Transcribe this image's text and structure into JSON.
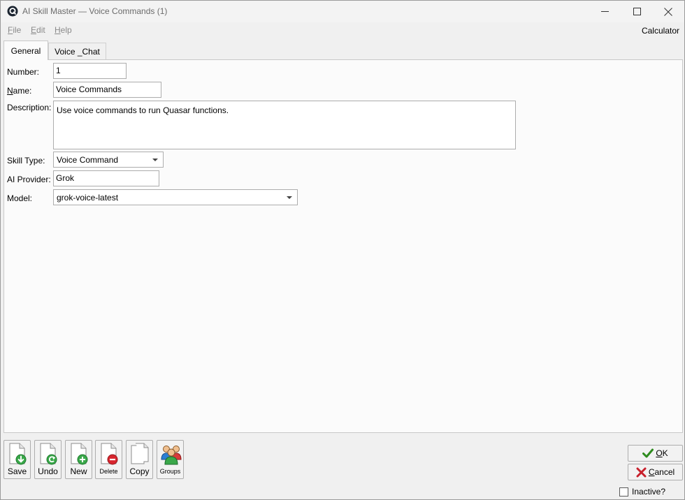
{
  "window": {
    "title": "AI Skill Master — Voice Commands (1)"
  },
  "menu": {
    "file": {
      "mnemonic": "F",
      "rest": "ile"
    },
    "edit": {
      "mnemonic": "E",
      "rest": "dit"
    },
    "help": {
      "mnemonic": "H",
      "rest": "elp"
    },
    "calculator": "Calculator"
  },
  "tabs": [
    {
      "label": "General",
      "active": true
    },
    {
      "label": "Voice _Chat",
      "active": false
    }
  ],
  "form": {
    "number": {
      "label": "Number:",
      "value": "1"
    },
    "name": {
      "label_mnemonic": "N",
      "label_rest": "ame:",
      "value": "Voice Commands"
    },
    "description": {
      "label": "Description:",
      "value": "Use voice commands to run Quasar functions."
    },
    "skill_type": {
      "label": "Skill Type:",
      "value": "Voice Command"
    },
    "ai_provider": {
      "label": "AI Provider:",
      "value": "Grok"
    },
    "model": {
      "label": "Model:",
      "value": "grok-voice-latest"
    }
  },
  "toolbar": {
    "save": "Save",
    "undo": "Undo",
    "new": "New",
    "delete": "Delete",
    "copy": "Copy",
    "groups": "Groups"
  },
  "dialog": {
    "ok": {
      "mnemonic": "O",
      "rest": "K"
    },
    "cancel": {
      "mnemonic": "C",
      "rest": "ancel"
    },
    "inactive_label": "Inactive?",
    "inactive_checked": false
  },
  "colors": {
    "ok_check": "#2e8b1e",
    "cancel_x": "#c8202c",
    "save_badge": "#3aa84a",
    "delete_badge": "#d8262e"
  },
  "icons": {
    "app": "quasar-logo-icon",
    "save": "save-document-icon",
    "undo": "undo-document-icon",
    "new": "new-document-icon",
    "delete": "delete-document-icon",
    "copy": "copy-document-icon",
    "groups": "group-people-icon"
  }
}
